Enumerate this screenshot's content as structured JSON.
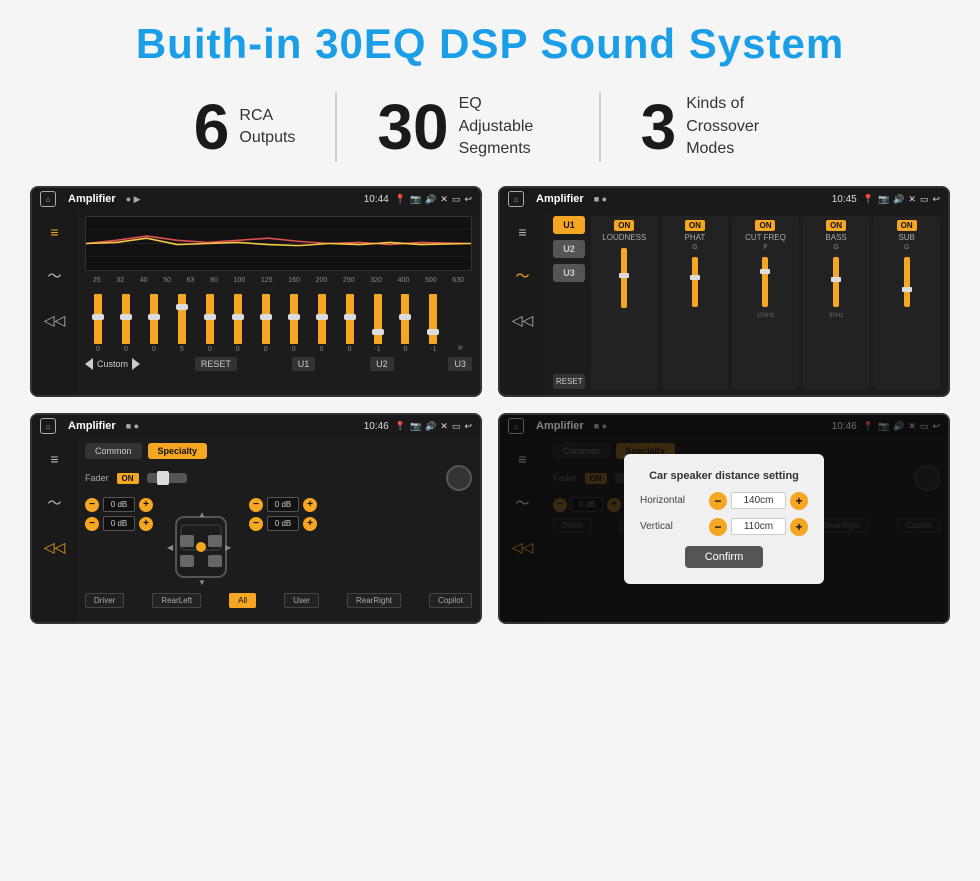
{
  "header": {
    "title": "Buith-in 30EQ DSP Sound System"
  },
  "stats": [
    {
      "id": "rca",
      "number": "6",
      "line1": "RCA",
      "line2": "Outputs"
    },
    {
      "id": "eq",
      "number": "30",
      "line1": "EQ Adjustable",
      "line2": "Segments"
    },
    {
      "id": "crossover",
      "number": "3",
      "line1": "Kinds of",
      "line2": "Crossover Modes"
    }
  ],
  "screens": {
    "screen1": {
      "title": "Amplifier",
      "time": "10:44",
      "freqs": [
        "25",
        "32",
        "40",
        "50",
        "63",
        "80",
        "100",
        "125",
        "160",
        "200",
        "250",
        "320",
        "400",
        "500",
        "630"
      ],
      "sliders_vals": [
        "0",
        "0",
        "0",
        "5",
        "0",
        "0",
        "0",
        "0",
        "0",
        "0",
        "-1",
        "0",
        "-1"
      ],
      "labels": {
        "custom": "Custom",
        "reset": "RESET",
        "u1": "U1",
        "u2": "U2",
        "u3": "U3"
      }
    },
    "screen2": {
      "title": "Amplifier",
      "time": "10:45",
      "presets": [
        "U1",
        "U2",
        "U3"
      ],
      "panels": [
        {
          "label": "LOUDNESS",
          "on": true
        },
        {
          "label": "PHAT",
          "on": true
        },
        {
          "label": "CUT FREQ",
          "on": true
        },
        {
          "label": "BASS",
          "on": true
        },
        {
          "label": "SUB",
          "on": true
        }
      ],
      "reset": "RESET"
    },
    "screen3": {
      "title": "Amplifier",
      "time": "10:46",
      "tabs": [
        "Common",
        "Specialty"
      ],
      "active_tab": "Specialty",
      "fader_label": "Fader",
      "fader_on": "ON",
      "vol_rows": [
        "0 dB",
        "0 dB",
        "0 dB",
        "0 dB"
      ],
      "bottom_btns": [
        "Driver",
        "RearLeft",
        "All",
        "User",
        "RearRight",
        "Copilot"
      ]
    },
    "screen4": {
      "title": "Amplifier",
      "time": "10:46",
      "tabs": [
        "Common",
        "Specialty"
      ],
      "dialog": {
        "title": "Car speaker distance setting",
        "horizontal_label": "Horizontal",
        "horizontal_value": "140cm",
        "vertical_label": "Vertical",
        "vertical_value": "110cm",
        "confirm_label": "Confirm"
      },
      "vol_rows": [
        "0 dB",
        "0 dB"
      ],
      "bottom_btns": [
        "Driver",
        "RearLeft",
        "All",
        "User",
        "RearRight",
        "Copilot"
      ]
    }
  }
}
